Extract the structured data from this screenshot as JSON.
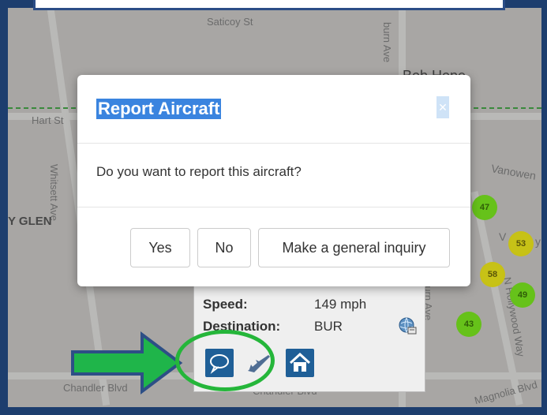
{
  "map": {
    "streets": {
      "saticoy": "Saticoy St",
      "hart": "Hart St",
      "whitsett": "Whitsett Ave",
      "vanowen": "Vanowen",
      "bob_hope": "Bob Hope",
      "y_glen": "Y GLEN",
      "chandler_left": "Chandler Blvd",
      "chandler_bottom": "Chandler Blvd",
      "hollywood_way": "N Hollywood Way",
      "magnolia": "Magnolia Blvd",
      "burbank_ave": "burn Ave",
      "victory": "V",
      "y_label": "y"
    },
    "clusters": [
      "47",
      "53",
      "58",
      "49",
      "43"
    ]
  },
  "info_card": {
    "speed_label": "Speed:",
    "speed_value": "149 mph",
    "destination_label": "Destination:",
    "destination_value": "BUR"
  },
  "modal": {
    "title": "Report Aircraft",
    "close_icon": "close-icon",
    "message": "Do you want to report this aircraft?",
    "buttons": {
      "yes": "Yes",
      "no": "No",
      "inquiry": "Make a general inquiry"
    }
  },
  "annotations": {
    "arrow_color": "#1fb54a",
    "circle_color": "#25b63a"
  },
  "icons": {
    "chat": "chat-bubble-icon",
    "plane": "plane-icon",
    "home": "home-icon",
    "globe": "globe-icon"
  }
}
